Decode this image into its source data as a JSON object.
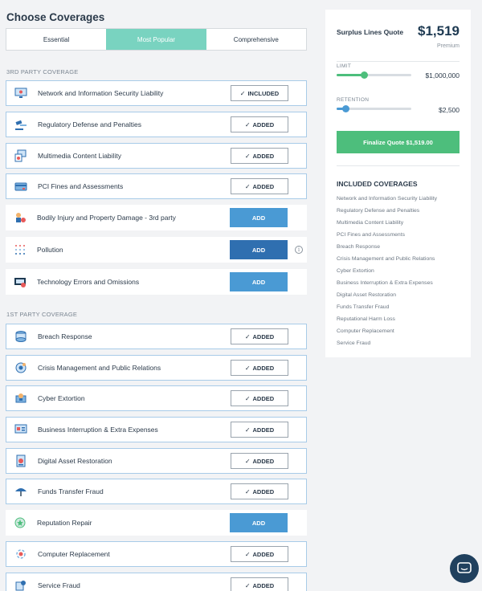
{
  "page": {
    "title": "Choose Coverages"
  },
  "tabs": [
    {
      "label": "Essential",
      "active": false
    },
    {
      "label": "Most Popular",
      "active": true
    },
    {
      "label": "Comprehensive",
      "active": false
    }
  ],
  "sections": {
    "third_party": "3RD PARTY COVERAGE",
    "first_party": "1ST PARTY COVERAGE"
  },
  "buttons": {
    "included": "INCLUDED",
    "added": "ADDED",
    "add": "ADD"
  },
  "coverages": [
    {
      "name": "Network and Information Security Liability",
      "status": "included",
      "icon": "monitor-icon"
    },
    {
      "name": "Regulatory Defense and Penalties",
      "status": "added",
      "icon": "gavel-icon"
    },
    {
      "name": "Multimedia Content Liability",
      "status": "added",
      "icon": "media-icon"
    },
    {
      "name": "PCI Fines and Assessments",
      "status": "added",
      "icon": "credit-card-icon"
    },
    {
      "name": "Bodily Injury and Property Damage - 3rd party",
      "status": "add",
      "icon": "injury-icon"
    },
    {
      "name": "Pollution",
      "status": "add",
      "icon": "pollution-icon"
    },
    {
      "name": "Technology Errors and Omissions",
      "status": "add",
      "icon": "tech-error-icon"
    },
    {
      "name": "Breach Response",
      "status": "added",
      "icon": "database-icon"
    },
    {
      "name": "Crisis Management and Public Relations",
      "status": "added",
      "icon": "crisis-icon"
    },
    {
      "name": "Cyber Extortion",
      "status": "added",
      "icon": "extortion-icon"
    },
    {
      "name": "Business Interruption & Extra Expenses",
      "status": "added",
      "icon": "interruption-icon"
    },
    {
      "name": "Digital Asset Restoration",
      "status": "added",
      "icon": "digital-asset-icon"
    },
    {
      "name": "Funds Transfer Fraud",
      "status": "added",
      "icon": "umbrella-icon"
    },
    {
      "name": "Reputation Repair",
      "status": "add",
      "icon": "reputation-icon"
    },
    {
      "name": "Computer Replacement",
      "status": "added",
      "icon": "computer-replace-icon"
    },
    {
      "name": "Service Fraud",
      "status": "added",
      "icon": "service-fraud-icon"
    }
  ],
  "quote": {
    "title": "Surplus Lines Quote",
    "price": "$1,519",
    "subtitle": "Premium",
    "limit_label": "LIMIT",
    "limit_value": "$1,000,000",
    "limit_level": 0.37,
    "retention_label": "RETENTION",
    "retention_value": "$2,500",
    "retention_level": 0.12,
    "finalize_label": "Finalize Quote $1,519.00",
    "included_title": "INCLUDED COVERAGES",
    "included": [
      "Network and Information Security Liability",
      "Regulatory Defense and Penalties",
      "Multimedia Content Liability",
      "PCI Fines and Assessments",
      "Breach Response",
      "Crisis Management and Public Relations",
      "Cyber Extortion",
      "Business Interruption & Extra Expenses",
      "Digital Asset Restoration",
      "Funds Transfer Fraud",
      "Reputational Harm Loss",
      "Computer Replacement",
      "Service Fraud"
    ]
  },
  "colors": {
    "accent_teal": "#79d3c0",
    "add_blue": "#4a9ad4",
    "add_blue_active": "#2f6fb0",
    "finalize_green": "#4dbe7c",
    "slider_green": "#4dbe7c",
    "slider_blue": "#4a9ad4",
    "chat_navy": "#20405e"
  }
}
